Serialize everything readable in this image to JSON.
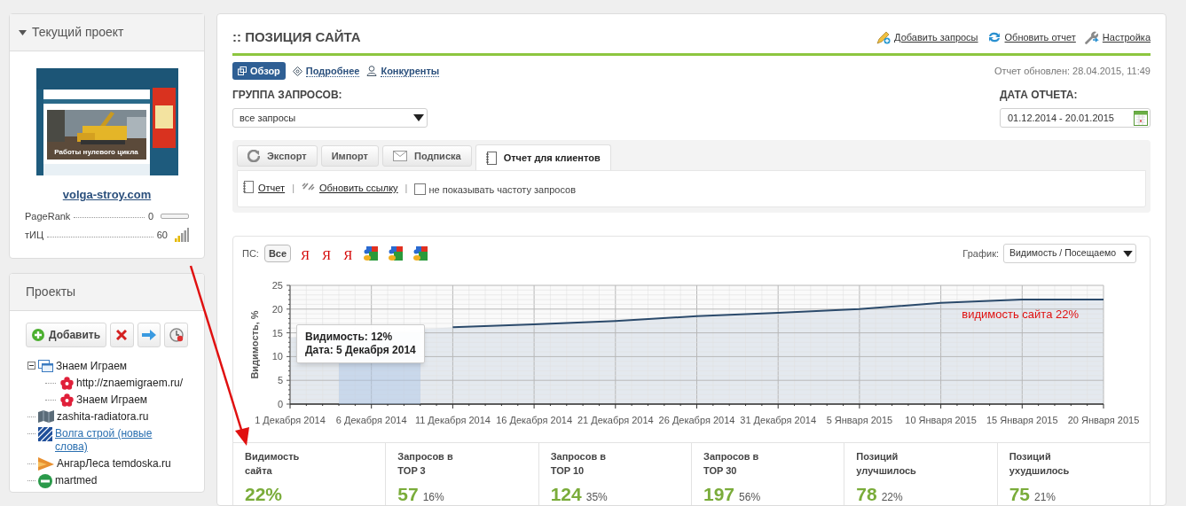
{
  "current_project": {
    "title": "Текущий проект",
    "thumbnail_caption": "Работы нулевого цикла",
    "site": "volga-stroy.com",
    "metrics": [
      {
        "kind": "bar",
        "label": "PageRank",
        "value": "0",
        "level": 0
      },
      {
        "kind": "signal",
        "label": "тИЦ",
        "value": "60"
      }
    ]
  },
  "projects": {
    "title": "Проекты",
    "add_button": "Добавить",
    "tree": [
      {
        "kind": "window",
        "label": "Знаем Играем",
        "expanded": true,
        "selected": false,
        "children": [
          {
            "kind": "flower",
            "label": "http://znaemigraem.ru/",
            "selected": false
          },
          {
            "kind": "flower",
            "label": "Знаем Играем",
            "selected": false
          }
        ]
      },
      {
        "kind": "map",
        "label": "zashita-radiatora.ru",
        "selected": false
      },
      {
        "kind": "stripes",
        "label": "Волга строй (новые слова)",
        "selected": true
      },
      {
        "kind": "triangle",
        "label": "АнгарЛеса temdoska.ru",
        "selected": false
      },
      {
        "kind": "circle",
        "label": "martmed",
        "selected": false
      }
    ]
  },
  "main": {
    "title": ":: ПОЗИЦИЯ САЙТА",
    "actions": [
      {
        "kind": "pencil",
        "label": "Добавить запросы"
      },
      {
        "kind": "refresh",
        "label": "Обновить отчет"
      },
      {
        "kind": "wrench",
        "label": "Настройка"
      }
    ],
    "tabs": [
      {
        "kind": "overview",
        "label": "Обзор",
        "selected": true
      },
      {
        "kind": "details",
        "label": "Подробнее",
        "selected": false
      },
      {
        "kind": "people",
        "label": "Конкуренты",
        "selected": false
      }
    ],
    "updated": "Отчет обновлен: 28.04.2015, 11:49",
    "group_label": "ГРУППА ЗАПРОСОВ:",
    "group_value": "все запросы",
    "date_label": "ДАТА ОТЧЕТА:",
    "date_value": "01.12.2014 - 20.01.2015",
    "tool_tabs": [
      {
        "kind": "export",
        "label": "Экспорт",
        "selected": false
      },
      {
        "kind": "none",
        "label": "Импорт",
        "selected": false
      },
      {
        "kind": "mail",
        "label": "Подписка",
        "selected": false
      },
      {
        "kind": "notebook",
        "label": "Отчет для клиентов",
        "selected": true
      }
    ],
    "report_link": "Отчет",
    "separators": [
      "|",
      "|"
    ],
    "refresh_link": "Обновить ссылку",
    "hide_frequency": {
      "label": "не показывать частоту запросов",
      "checked": false
    }
  },
  "chart": {
    "ps_label": "ПС:",
    "engines": [
      {
        "kind": "all",
        "label": "Все",
        "selected": true
      },
      {
        "kind": "yandex",
        "label": "Я",
        "selected": false
      },
      {
        "kind": "yandex",
        "label": "Я",
        "selected": false
      },
      {
        "kind": "yandex",
        "label": "Я",
        "selected": false
      },
      {
        "kind": "google",
        "selected": false
      },
      {
        "kind": "google",
        "selected": false
      },
      {
        "kind": "google",
        "selected": false
      }
    ],
    "graph_label": "График:",
    "graph_value": "Видимость / Посещаемо",
    "tooltip": [
      "Видимость: 12%",
      "Дата: 5 Декабря 2014"
    ],
    "chart_data": {
      "type": "area",
      "ylabel": "Видимость, %",
      "categories": [
        "1 Декабря 2014",
        "6 Декабря 2014",
        "11 Декабря 2014",
        "16 Декабря 2014",
        "21 Декабря 2014",
        "26 Декабря 2014",
        "31 Декабря 2014",
        "5 Января 2015",
        "10 Января 2015",
        "15 Января 2015",
        "20 Января 2015"
      ],
      "series": [
        {
          "color": "#2b4a6b",
          "values": [
            14,
            null,
            16.2,
            16.8,
            17.5,
            18.5,
            19.2,
            20,
            21.3,
            22,
            22
          ]
        }
      ],
      "ylim": [
        0,
        25
      ],
      "yticks": [
        0,
        5,
        10,
        15,
        20,
        25
      ],
      "grid": true,
      "annotations": [
        "видимость сайта 22%"
      ]
    }
  },
  "stats": [
    {
      "label": "Видимость\nсайта",
      "value": "22%"
    },
    {
      "label": "Запросов в\nTOP 3",
      "value": "57",
      "percent": "16%"
    },
    {
      "label": "Запросов в\nTOP 10",
      "value": "124",
      "percent": "35%"
    },
    {
      "label": "Запросов в\nTOP 30",
      "value": "197",
      "percent": "56%"
    },
    {
      "label": "Позиций\nулучшилось",
      "value": "78",
      "percent": "22%"
    },
    {
      "label": "Позиций\nухудшилось",
      "value": "75",
      "percent": "21%"
    }
  ]
}
